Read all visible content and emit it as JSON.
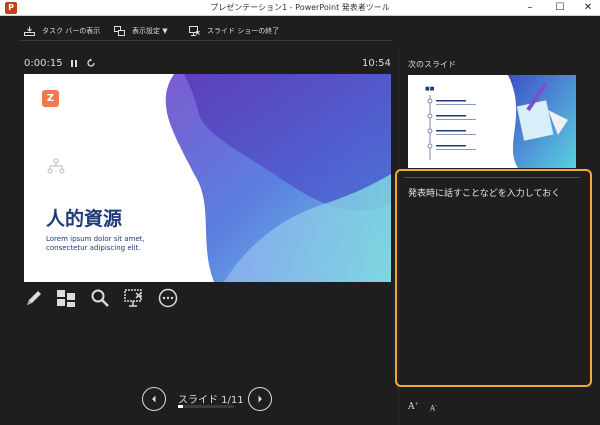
{
  "window": {
    "title": "プレゼンテーション1 - PowerPoint 発表者ツール",
    "app_icon": "P",
    "controls": [
      "–",
      "☐",
      "✕"
    ]
  },
  "toolbar": {
    "taskbar_label": "タスク バーの表示",
    "display_settings_label": "表示設定 ▼",
    "end_show_label": "スライド ショーの終了"
  },
  "timer": {
    "elapsed": "0:00:15",
    "clock": "10:54"
  },
  "slide": {
    "logo": "Z",
    "title": "人的資源",
    "subtitle_line1": "Lorem ipsum dolor sit amet,",
    "subtitle_line2": "consectetur adipiscing elit."
  },
  "tools": [
    "pen-icon",
    "thumbnails-icon",
    "zoom-icon",
    "screen-icon",
    "more-icon"
  ],
  "navigation": {
    "counter": "スライド 1/11",
    "progress": 0.0909
  },
  "next_slide": {
    "label": "次のスライド"
  },
  "notes": {
    "placeholder": "発表時に話すことなどを入力しておく"
  },
  "font_controls": {
    "increase": "A",
    "decrease": "A"
  },
  "colors": {
    "accent": "#f2a93b",
    "background": "#1e1e1e",
    "slide_title": "#1f3a78"
  }
}
